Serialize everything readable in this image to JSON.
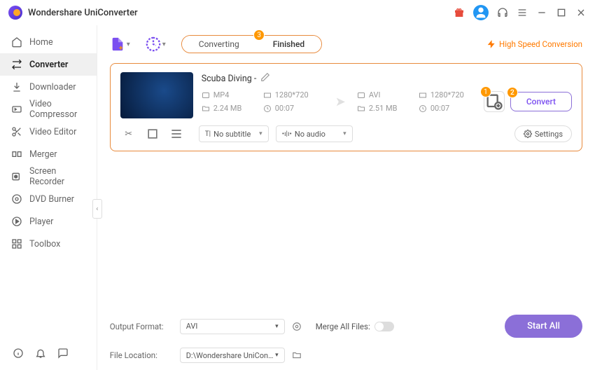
{
  "app": {
    "title": "Wondershare UniConverter"
  },
  "titlebar": {},
  "sidebar": {
    "items": [
      {
        "label": "Home"
      },
      {
        "label": "Converter"
      },
      {
        "label": "Downloader"
      },
      {
        "label": "Video Compressor"
      },
      {
        "label": "Video Editor"
      },
      {
        "label": "Merger"
      },
      {
        "label": "Screen Recorder"
      },
      {
        "label": "DVD Burner"
      },
      {
        "label": "Player"
      },
      {
        "label": "Toolbox"
      }
    ]
  },
  "tabs": {
    "converting": "Converting",
    "finished": "Finished",
    "badge": "3"
  },
  "hspeed": {
    "label": "High Speed Conversion"
  },
  "file": {
    "title": "Scuba Diving  -",
    "src": {
      "format": "MP4",
      "res": "1280*720",
      "size": "2.24 MB",
      "dur": "00:07"
    },
    "dst": {
      "format": "AVI",
      "res": "1280*720",
      "size": "2.51 MB",
      "dur": "00:07"
    },
    "convert_label": "Convert",
    "badge1": "1",
    "badge2": "2",
    "subtitle": {
      "label": "No subtitle"
    },
    "audio": {
      "label": "No audio"
    },
    "settings": {
      "label": "Settings"
    }
  },
  "footer": {
    "output_label": "Output Format:",
    "output_value": "AVI",
    "location_label": "File Location:",
    "location_value": "D:\\Wondershare UniConverter",
    "merge_label": "Merge All Files:",
    "startall": "Start All"
  }
}
